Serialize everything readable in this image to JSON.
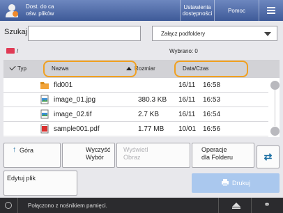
{
  "header": {
    "user_label": "Dost. do ca\nośw. plików",
    "accessibility_label": "Ustawienia\ndostępności",
    "help_label": "Pomoc"
  },
  "search": {
    "label": "Szukaj",
    "value": "",
    "subfolder_option": "Załącz podfoldery"
  },
  "path": {
    "text": "/",
    "selected": "Wybrano: 0"
  },
  "table": {
    "col_type": "Typ",
    "col_name": "Nazwa",
    "col_size": "Rozmiar",
    "col_date": "Data/Czas",
    "rows": [
      {
        "icon": "folder-icon",
        "name": "fld001",
        "size": "",
        "date": "16/11",
        "time": "16:58"
      },
      {
        "icon": "image-file-icon",
        "name": "image_01.jpg",
        "size": "380.3 KB",
        "date": "16/11",
        "time": "16:53"
      },
      {
        "icon": "image-file-icon",
        "name": "image_02.tif",
        "size": "2.7 KB",
        "date": "16/11",
        "time": "16:54"
      },
      {
        "icon": "pdf-file-icon",
        "name": "sample001.pdf",
        "size": "1.77 MB",
        "date": "10/01",
        "time": "16:56"
      }
    ]
  },
  "buttons": {
    "up": "Góra",
    "clear_line1": "Wyczyść",
    "clear_line2": "Wybór",
    "preview_line1": "Wyświetl",
    "preview_line2": "Obraz",
    "folder_ops_line1": "Operacje",
    "folder_ops_line2": "dla Folderu",
    "edit": "Edytuj plik",
    "print": "Drukuj"
  },
  "status": {
    "text": "Połączono z nośnikiem pamięci."
  },
  "colors": {
    "accent": "#3e5a98",
    "highlight": "#f0a020",
    "print_disabled": "#aac8ee"
  }
}
